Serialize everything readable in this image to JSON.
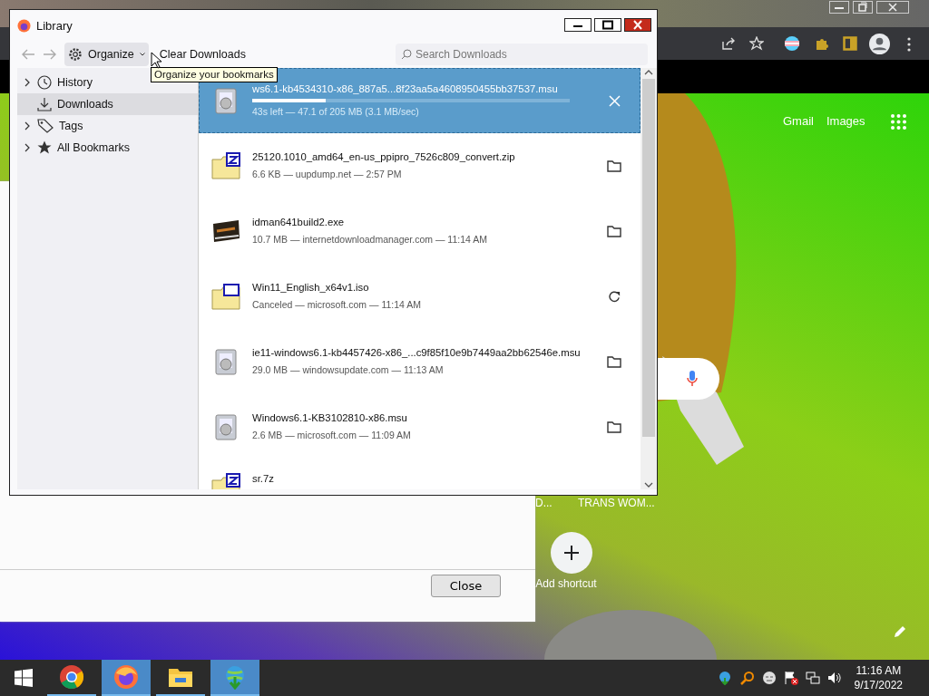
{
  "browser": {
    "links": [
      "Gmail",
      "Images"
    ],
    "shortcuts": [
      {
        "label": "D...",
        "kind": "tile"
      },
      {
        "label": "TRANS WOM...",
        "kind": "tile"
      },
      {
        "label": "Add shortcut",
        "kind": "add"
      }
    ]
  },
  "dialog": {
    "button": "Close"
  },
  "library": {
    "title": "Library",
    "toolbar": {
      "organize": "Organize",
      "clear": "Clear Downloads",
      "search_placeholder": "Search Downloads"
    },
    "tooltip": "Organize your bookmarks",
    "sidebar": [
      {
        "label": "History",
        "kind": "history",
        "expandable": true,
        "selected": false
      },
      {
        "label": "Downloads",
        "kind": "downloads",
        "expandable": false,
        "selected": true
      },
      {
        "label": "Tags",
        "kind": "tags",
        "expandable": true,
        "selected": false
      },
      {
        "label": "All Bookmarks",
        "kind": "bookmarks",
        "expandable": true,
        "selected": false
      }
    ],
    "downloads": [
      {
        "name": "ws6.1-kb4534310-x86_887a5...8f23aa5a4608950455bb37537.msu",
        "status": "43s left — 47.1 of 205 MB (3.1 MB/sec)",
        "kind": "installer",
        "action": {
          "kind": "cancel"
        },
        "selected": true,
        "level": 0.23
      },
      {
        "name": "25120.1010_amd64_en-us_ppipro_7526c809_convert.zip",
        "status": "6.6 KB — uupdump.net — 2:57 PM",
        "kind": "archive",
        "action": {
          "kind": "folder"
        },
        "selected": false
      },
      {
        "name": "idman641build2.exe",
        "status": "10.7 MB — internetdownloadmanager.com — 11:14 AM",
        "kind": "program",
        "action": {
          "kind": "folder"
        },
        "selected": false
      },
      {
        "name": "Win11_English_x64v1.iso",
        "status": "Canceled — microsoft.com — 11:14 AM",
        "kind": "disc",
        "action": {
          "kind": "retry"
        },
        "selected": false
      },
      {
        "name": "ie11-windows6.1-kb4457426-x86_...c9f85f10e9b7449aa2bb62546e.msu",
        "status": "29.0 MB — windowsupdate.com — 11:13 AM",
        "kind": "installer",
        "action": {
          "kind": "folder"
        },
        "selected": false
      },
      {
        "name": "Windows6.1-KB3102810-x86.msu",
        "status": "2.6 MB — microsoft.com — 11:09 AM",
        "kind": "installer",
        "action": {
          "kind": "folder"
        },
        "selected": false
      },
      {
        "name": "sr.7z",
        "kind": "archive",
        "selected": false
      }
    ]
  },
  "taskbar": {
    "apps": [
      {
        "kind": "chrome",
        "active": false
      },
      {
        "kind": "firefox",
        "active": true
      },
      {
        "kind": "explorer",
        "active": false
      },
      {
        "kind": "download-manager",
        "active": true
      }
    ],
    "time": "11:16 AM",
    "date": "9/17/2022"
  }
}
